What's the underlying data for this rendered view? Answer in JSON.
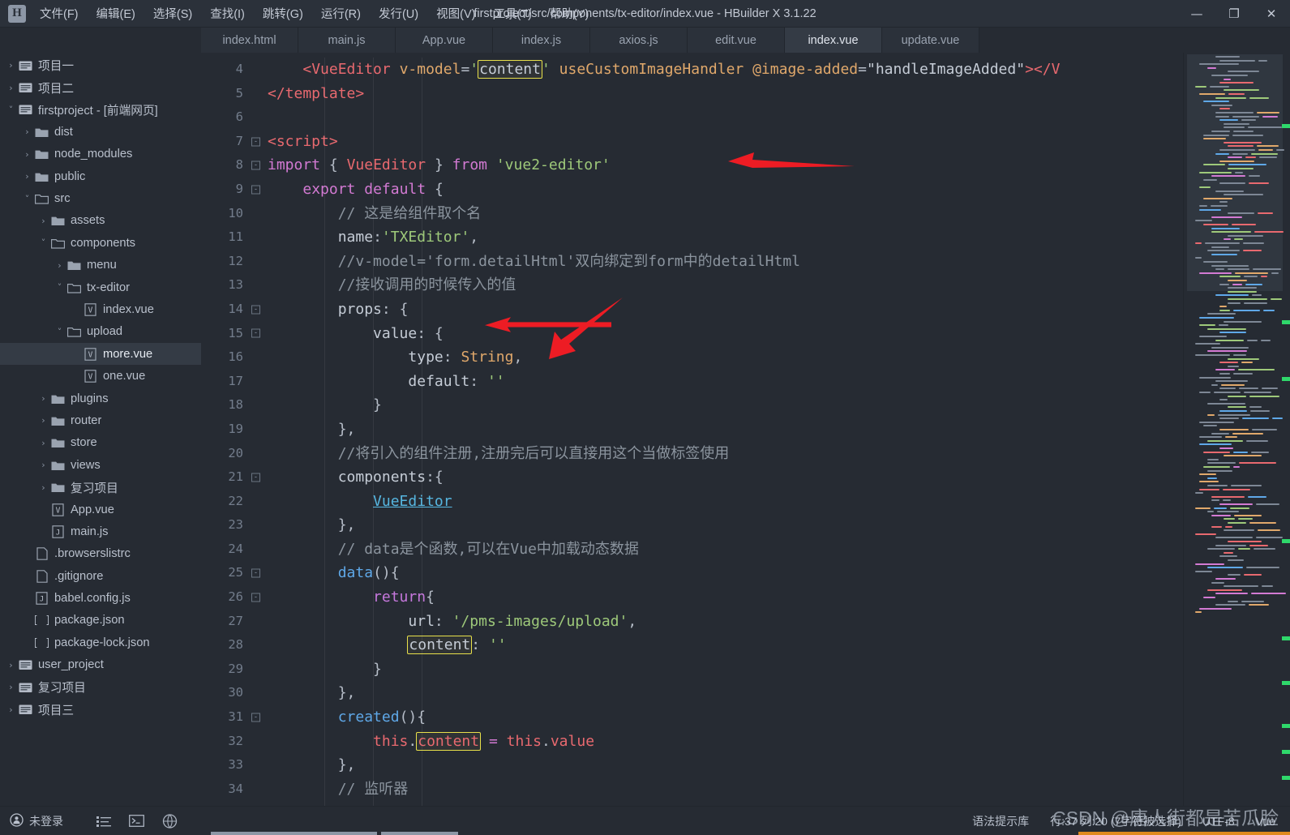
{
  "window": {
    "title": "firstproject/src/components/tx-editor/index.vue - HBuilder X 3.1.22",
    "logo": "H",
    "minimize": "—",
    "maximize": "❐",
    "close": "✕"
  },
  "menubar": {
    "items": [
      {
        "label": "文件(F)",
        "name": "menu-file"
      },
      {
        "label": "编辑(E)",
        "name": "menu-edit"
      },
      {
        "label": "选择(S)",
        "name": "menu-select"
      },
      {
        "label": "查找(I)",
        "name": "menu-find"
      },
      {
        "label": "跳转(G)",
        "name": "menu-goto"
      },
      {
        "label": "运行(R)",
        "name": "menu-run"
      },
      {
        "label": "发行(U)",
        "name": "menu-publish"
      },
      {
        "label": "视图(V)",
        "name": "menu-view"
      },
      {
        "label": "工具(T)",
        "name": "menu-tools"
      },
      {
        "label": "帮助(Y)",
        "name": "menu-help"
      }
    ]
  },
  "tabs": [
    {
      "label": "index.html",
      "active": false
    },
    {
      "label": "main.js",
      "active": false
    },
    {
      "label": "App.vue",
      "active": false
    },
    {
      "label": "index.js",
      "active": false
    },
    {
      "label": "axios.js",
      "active": false
    },
    {
      "label": "edit.vue",
      "active": false
    },
    {
      "label": "index.vue",
      "active": true
    },
    {
      "label": "update.vue",
      "active": false
    }
  ],
  "sidebar": {
    "items": [
      {
        "label": "项目一",
        "indent": 0,
        "arrow": "right",
        "icon": "project-folder",
        "selected": false
      },
      {
        "label": "项目二",
        "indent": 0,
        "arrow": "right",
        "icon": "project-folder",
        "selected": false
      },
      {
        "label": "firstproject - [前端网页]",
        "indent": 0,
        "arrow": "down",
        "icon": "project-folder",
        "selected": false
      },
      {
        "label": "dist",
        "indent": 1,
        "arrow": "right",
        "icon": "folder",
        "selected": false
      },
      {
        "label": "node_modules",
        "indent": 1,
        "arrow": "right",
        "icon": "folder",
        "selected": false
      },
      {
        "label": "public",
        "indent": 1,
        "arrow": "right",
        "icon": "folder",
        "selected": false
      },
      {
        "label": "src",
        "indent": 1,
        "arrow": "down",
        "icon": "folder-open",
        "selected": false
      },
      {
        "label": "assets",
        "indent": 2,
        "arrow": "right",
        "icon": "folder",
        "selected": false
      },
      {
        "label": "components",
        "indent": 2,
        "arrow": "down",
        "icon": "folder-open",
        "selected": false
      },
      {
        "label": "menu",
        "indent": 3,
        "arrow": "right",
        "icon": "folder",
        "selected": false
      },
      {
        "label": "tx-editor",
        "indent": 3,
        "arrow": "down",
        "icon": "folder-open",
        "selected": false
      },
      {
        "label": "index.vue",
        "indent": 4,
        "arrow": "none",
        "icon": "vue-file",
        "selected": false
      },
      {
        "label": "upload",
        "indent": 3,
        "arrow": "down",
        "icon": "folder-open",
        "selected": false
      },
      {
        "label": "more.vue",
        "indent": 4,
        "arrow": "none",
        "icon": "vue-file",
        "selected": true
      },
      {
        "label": "one.vue",
        "indent": 4,
        "arrow": "none",
        "icon": "vue-file",
        "selected": false
      },
      {
        "label": "plugins",
        "indent": 2,
        "arrow": "right",
        "icon": "folder",
        "selected": false
      },
      {
        "label": "router",
        "indent": 2,
        "arrow": "right",
        "icon": "folder",
        "selected": false
      },
      {
        "label": "store",
        "indent": 2,
        "arrow": "right",
        "icon": "folder",
        "selected": false
      },
      {
        "label": "views",
        "indent": 2,
        "arrow": "right",
        "icon": "folder",
        "selected": false
      },
      {
        "label": "复习项目",
        "indent": 2,
        "arrow": "right",
        "icon": "folder",
        "selected": false
      },
      {
        "label": "App.vue",
        "indent": 2,
        "arrow": "none",
        "icon": "vue-file",
        "selected": false
      },
      {
        "label": "main.js",
        "indent": 2,
        "arrow": "none",
        "icon": "js-file",
        "selected": false
      },
      {
        "label": ".browserslistrc",
        "indent": 1,
        "arrow": "none",
        "icon": "text-file",
        "selected": false
      },
      {
        "label": ".gitignore",
        "indent": 1,
        "arrow": "none",
        "icon": "text-file",
        "selected": false
      },
      {
        "label": "babel.config.js",
        "indent": 1,
        "arrow": "none",
        "icon": "js-file",
        "selected": false
      },
      {
        "label": "package.json",
        "indent": 1,
        "arrow": "none",
        "icon": "json-file",
        "selected": false
      },
      {
        "label": "package-lock.json",
        "indent": 1,
        "arrow": "none",
        "icon": "json-file",
        "selected": false
      },
      {
        "label": "user_project",
        "indent": 0,
        "arrow": "right",
        "icon": "project-folder",
        "selected": false
      },
      {
        "label": "复习项目",
        "indent": 0,
        "arrow": "right",
        "icon": "project-folder",
        "selected": false
      },
      {
        "label": "项目三",
        "indent": 0,
        "arrow": "right",
        "icon": "project-folder",
        "selected": false
      }
    ]
  },
  "editor": {
    "first_line": 4,
    "lines": [
      {
        "n": 4,
        "fold": "",
        "html": "<span class=\"t-plain\">    </span><span class=\"t-tag\">&lt;VueEditor</span> <span class=\"t-attr\">v-model</span><span class=\"t-punc\">=</span><span class=\"t-str\">'</span><span class=\"hl-box t-plain\">content</span><span class=\"t-str\">'</span> <span class=\"t-attr\">useCustomImageHandler</span> <span class=\"t-attr\">@image-added</span><span class=\"t-punc\">=</span><span class=\"t-plain\">\"handleImageAdded\"</span><span class=\"t-tag\">&gt;&lt;/V</span>"
      },
      {
        "n": 5,
        "fold": "",
        "html": "<span class=\"t-tag\">&lt;/template&gt;</span>"
      },
      {
        "n": 6,
        "fold": "",
        "html": ""
      },
      {
        "n": 7,
        "fold": "-",
        "html": "<span class=\"t-tag\">&lt;script&gt;</span>"
      },
      {
        "n": 8,
        "fold": "-",
        "html": "<span class=\"t-kw\">import</span> <span class=\"t-punc\">{</span> <span class=\"t-tag\">VueEditor</span> <span class=\"t-punc\">}</span> <span class=\"t-kw\">from</span> <span class=\"t-str\">'vue2-editor'</span>"
      },
      {
        "n": 9,
        "fold": "-",
        "html": "    <span class=\"t-kw\">export</span> <span class=\"t-kw\">default</span> <span class=\"t-punc\">{</span>"
      },
      {
        "n": 10,
        "fold": "",
        "html": "        <span class=\"t-cmt\">// 这是给组件取个名</span>"
      },
      {
        "n": 11,
        "fold": "",
        "html": "        <span class=\"t-prop\">name</span><span class=\"t-punc\">:</span><span class=\"t-str\">'TXEditor'</span><span class=\"t-punc\">,</span>"
      },
      {
        "n": 12,
        "fold": "",
        "html": "        <span class=\"t-cmt\">//v-model='form.detailHtml'双向绑定到form中的detailHtml</span>"
      },
      {
        "n": 13,
        "fold": "",
        "html": "        <span class=\"t-cmt\">//接收调用的时候传入的值</span>"
      },
      {
        "n": 14,
        "fold": "-",
        "html": "        <span class=\"t-prop\">props</span><span class=\"t-punc\">: {</span>"
      },
      {
        "n": 15,
        "fold": "-",
        "html": "            <span class=\"t-prop\">value</span><span class=\"t-punc\">: {</span>"
      },
      {
        "n": 16,
        "fold": "",
        "html": "                <span class=\"t-prop\">type</span><span class=\"t-punc\">:</span> <span class=\"t-type\">String</span><span class=\"t-punc\">,</span>"
      },
      {
        "n": 17,
        "fold": "",
        "html": "                <span class=\"t-prop\">default</span><span class=\"t-punc\">:</span> <span class=\"t-str\">''</span>"
      },
      {
        "n": 18,
        "fold": "",
        "html": "            <span class=\"t-punc\">}</span>"
      },
      {
        "n": 19,
        "fold": "",
        "html": "        <span class=\"t-punc\">},</span>"
      },
      {
        "n": 20,
        "fold": "",
        "html": "        <span class=\"t-cmt\">//将引入的组件注册,注册完后可以直接用这个当做标签使用</span>"
      },
      {
        "n": 21,
        "fold": "-",
        "html": "        <span class=\"t-prop\">components</span><span class=\"t-punc\">:{</span>"
      },
      {
        "n": 22,
        "fold": "",
        "html": "            <span class=\"t-link\">VueEditor</span>"
      },
      {
        "n": 23,
        "fold": "",
        "html": "        <span class=\"t-punc\">},</span>"
      },
      {
        "n": 24,
        "fold": "",
        "html": "        <span class=\"t-cmt\">// data是个函数,可以在Vue中加载动态数据</span>"
      },
      {
        "n": 25,
        "fold": "-",
        "html": "        <span class=\"t-fn\">data</span><span class=\"t-punc\">(){</span>"
      },
      {
        "n": 26,
        "fold": "-",
        "html": "            <span class=\"t-kw2\">return</span><span class=\"t-punc\">{</span>"
      },
      {
        "n": 27,
        "fold": "",
        "html": "                <span class=\"t-prop\">url</span><span class=\"t-punc\">:</span> <span class=\"t-str\">'/pms-images/upload'</span><span class=\"t-punc\">,</span>"
      },
      {
        "n": 28,
        "fold": "",
        "html": "                <span class=\"hl-box t-prop\">content</span><span class=\"t-punc\">:</span> <span class=\"t-str\">''</span>"
      },
      {
        "n": 29,
        "fold": "",
        "html": "            <span class=\"t-punc\">}</span>"
      },
      {
        "n": 30,
        "fold": "",
        "html": "        <span class=\"t-punc\">},</span>"
      },
      {
        "n": 31,
        "fold": "-",
        "html": "        <span class=\"t-fn\">created</span><span class=\"t-punc\">(){</span>"
      },
      {
        "n": 32,
        "fold": "",
        "html": "            <span class=\"t-this\">this</span><span class=\"t-punc\">.</span><span class=\"hl-box t-this\">content</span> <span class=\"t-op\">=</span> <span class=\"t-this\">this</span><span class=\"t-punc\">.</span><span class=\"t-this\">value</span>"
      },
      {
        "n": 33,
        "fold": "",
        "html": "        <span class=\"t-punc\">},</span>"
      },
      {
        "n": 34,
        "fold": "",
        "html": "        <span class=\"t-cmt\">// 监听器</span>"
      }
    ],
    "plain_text_lines": [
      "    <VueEditor v-model='content' useCustomImageHandler @image-added=\"handleImageAdded\"></V",
      "</template>",
      "",
      "<script>",
      "import { VueEditor } from 'vue2-editor'",
      "    export default {",
      "        // 这是给组件取个名",
      "        name:'TXEditor',",
      "        //v-model='form.detailHtml'双向绑定到form中的detailHtml",
      "        //接收调用的时候传入的值",
      "        props: {",
      "            value: {",
      "                type: String,",
      "                default: ''",
      "            }",
      "        },",
      "        //将引入的组件注册,注册完后可以直接用这个当做标签使用",
      "        components:{",
      "            VueEditor",
      "        },",
      "        // data是个函数,可以在Vue中加载动态数据",
      "        data(){",
      "            return{",
      "                url: '/pms-images/upload',",
      "                content: ''",
      "            }",
      "        },",
      "        created(){",
      "            this.content = this.value",
      "        },",
      "        // 监听器"
    ]
  },
  "statusbar": {
    "login": "未登录",
    "syntax_lib": "语法提示库",
    "position": "行:37  列:20 (7字符被选择)",
    "encoding": "UTF-8",
    "language": "Vue"
  },
  "watermark": "CSDN @唐人街都是苦瓜脸",
  "colors": {
    "chrome": "#2b313a",
    "background": "#262b33",
    "active_tab": "#343b45",
    "accent": "#e08a1e",
    "highlight_box": "#e8e04a",
    "annotation_arrow": "#ed1c24",
    "minimap_marker": "#2fd86b"
  }
}
